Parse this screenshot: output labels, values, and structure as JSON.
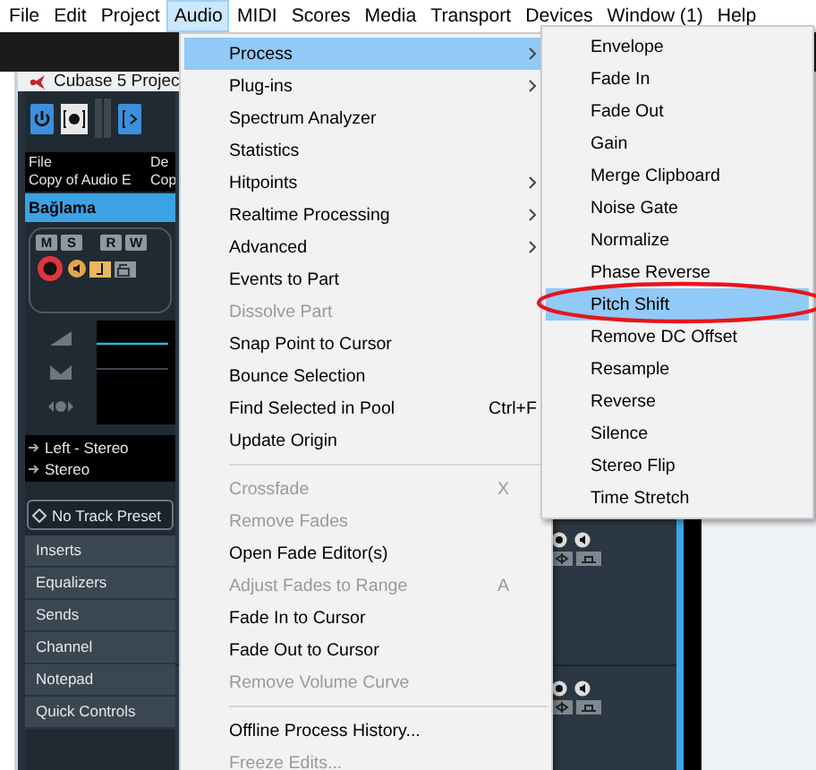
{
  "menubar": [
    {
      "label": "File",
      "selected": false
    },
    {
      "label": "Edit",
      "selected": false
    },
    {
      "label": "Project",
      "selected": false
    },
    {
      "label": "Audio",
      "selected": true
    },
    {
      "label": "MIDI",
      "selected": false
    },
    {
      "label": "Scores",
      "selected": false
    },
    {
      "label": "Media",
      "selected": false
    },
    {
      "label": "Transport",
      "selected": false
    },
    {
      "label": "Devices",
      "selected": false
    },
    {
      "label": "Window (1)",
      "selected": false
    },
    {
      "label": "Help",
      "selected": false
    }
  ],
  "window": {
    "title": "Cubase 5 Projec"
  },
  "inspector": {
    "file_info": {
      "headers": [
        "File",
        "De"
      ],
      "values": [
        "Copy of Audio E",
        "Cop"
      ]
    },
    "track_name": "Bağlama",
    "track_buttons": [
      "M",
      "S",
      "R",
      "W"
    ],
    "record_enabled": true,
    "routing": [
      "Left - Stereo",
      "Stereo"
    ],
    "preset": "No Track Preset",
    "sections": [
      "Inserts",
      "Equalizers",
      "Sends",
      "Channel",
      "Notepad",
      "Quick Controls"
    ]
  },
  "audio_menu": {
    "groups": [
      [
        {
          "label": "Process",
          "submenu": true,
          "disabled": false,
          "selected": true
        },
        {
          "label": "Plug-ins",
          "submenu": true,
          "disabled": false,
          "selected": false
        },
        {
          "label": "Spectrum Analyzer",
          "submenu": false,
          "disabled": false,
          "selected": false
        },
        {
          "label": "Statistics",
          "submenu": false,
          "disabled": false,
          "selected": false
        },
        {
          "label": "Hitpoints",
          "submenu": true,
          "disabled": false,
          "selected": false
        },
        {
          "label": "Realtime Processing",
          "submenu": true,
          "disabled": false,
          "selected": false
        },
        {
          "label": "Advanced",
          "submenu": true,
          "disabled": false,
          "selected": false
        },
        {
          "label": "Events to Part",
          "submenu": false,
          "disabled": false,
          "selected": false
        },
        {
          "label": "Dissolve Part",
          "submenu": false,
          "disabled": true,
          "selected": false
        },
        {
          "label": "Snap Point to Cursor",
          "submenu": false,
          "disabled": false,
          "selected": false
        },
        {
          "label": "Bounce Selection",
          "submenu": false,
          "disabled": false,
          "selected": false
        },
        {
          "label": "Find Selected in Pool",
          "shortcut": "Ctrl+F",
          "submenu": false,
          "disabled": false,
          "selected": false
        },
        {
          "label": "Update Origin",
          "submenu": false,
          "disabled": false,
          "selected": false
        }
      ],
      [
        {
          "label": "Crossfade",
          "shortcut": "X",
          "submenu": false,
          "disabled": true,
          "selected": false
        },
        {
          "label": "Remove Fades",
          "submenu": false,
          "disabled": true,
          "selected": false
        },
        {
          "label": "Open Fade Editor(s)",
          "submenu": false,
          "disabled": false,
          "selected": false
        },
        {
          "label": "Adjust Fades to Range",
          "shortcut": "A",
          "submenu": false,
          "disabled": true,
          "selected": false
        },
        {
          "label": "Fade In to Cursor",
          "submenu": false,
          "disabled": false,
          "selected": false
        },
        {
          "label": "Fade Out to Cursor",
          "submenu": false,
          "disabled": false,
          "selected": false
        },
        {
          "label": "Remove Volume Curve",
          "submenu": false,
          "disabled": true,
          "selected": false
        }
      ],
      [
        {
          "label": "Offline Process History...",
          "submenu": false,
          "disabled": false,
          "selected": false
        },
        {
          "label": "Freeze Edits...",
          "submenu": false,
          "disabled": true,
          "selected": false
        }
      ]
    ]
  },
  "process_menu": {
    "groups": [
      [
        {
          "label": "Envelope",
          "submenu": false,
          "disabled": false,
          "selected": false,
          "circled": false
        },
        {
          "label": "Fade In",
          "submenu": false,
          "disabled": false,
          "selected": false,
          "circled": false
        },
        {
          "label": "Fade Out",
          "submenu": false,
          "disabled": false,
          "selected": false,
          "circled": false
        },
        {
          "label": "Gain",
          "submenu": false,
          "disabled": false,
          "selected": false,
          "circled": false
        },
        {
          "label": "Merge Clipboard",
          "submenu": false,
          "disabled": false,
          "selected": false,
          "circled": false
        },
        {
          "label": "Noise Gate",
          "submenu": false,
          "disabled": false,
          "selected": false,
          "circled": false
        },
        {
          "label": "Normalize",
          "submenu": false,
          "disabled": false,
          "selected": false,
          "circled": false
        },
        {
          "label": "Phase Reverse",
          "submenu": false,
          "disabled": false,
          "selected": false,
          "circled": false
        },
        {
          "label": "Pitch Shift",
          "submenu": false,
          "disabled": false,
          "selected": true,
          "circled": true
        },
        {
          "label": "Remove DC Offset",
          "submenu": false,
          "disabled": false,
          "selected": false,
          "circled": false
        },
        {
          "label": "Resample",
          "submenu": false,
          "disabled": false,
          "selected": false,
          "circled": false
        },
        {
          "label": "Reverse",
          "submenu": false,
          "disabled": false,
          "selected": false,
          "circled": false
        },
        {
          "label": "Silence",
          "submenu": false,
          "disabled": false,
          "selected": false,
          "circled": false
        },
        {
          "label": "Stereo Flip",
          "submenu": false,
          "disabled": false,
          "selected": false,
          "circled": false
        },
        {
          "label": "Time Stretch",
          "submenu": false,
          "disabled": false,
          "selected": false,
          "circled": false
        }
      ]
    ]
  }
}
